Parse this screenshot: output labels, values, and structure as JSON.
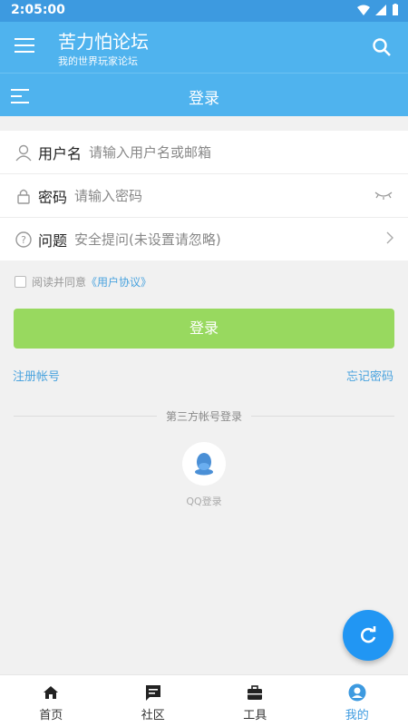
{
  "status_bar": {
    "time": "2:05:00"
  },
  "app_bar": {
    "title": "苦力怕论坛",
    "subtitle": "我的世界玩家论坛"
  },
  "sub_bar": {
    "title": "登录"
  },
  "form": {
    "username": {
      "label": "用户名",
      "placeholder": "请输入用户名或邮箱"
    },
    "password": {
      "label": "密码",
      "placeholder": "请输入密码"
    },
    "question": {
      "label": "问题",
      "placeholder": "安全提问(未设置请忽略)"
    }
  },
  "agree": {
    "text": "阅读并同意",
    "link": "《用户协议》"
  },
  "login_button": "登录",
  "register_link": "注册帐号",
  "forgot_link": "忘记密码",
  "third_party": {
    "label": "第三方帐号登录",
    "qq_label": "QQ登录"
  },
  "nav": [
    {
      "label": "首页",
      "icon": "home-icon"
    },
    {
      "label": "社区",
      "icon": "chat-icon"
    },
    {
      "label": "工具",
      "icon": "toolbox-icon"
    },
    {
      "label": "我的",
      "icon": "account-icon"
    }
  ],
  "colors": {
    "primary": "#4fb3ee",
    "status": "#3d9ae0",
    "button": "#98d95f",
    "link": "#4aa3de",
    "fab": "#2196f3"
  }
}
